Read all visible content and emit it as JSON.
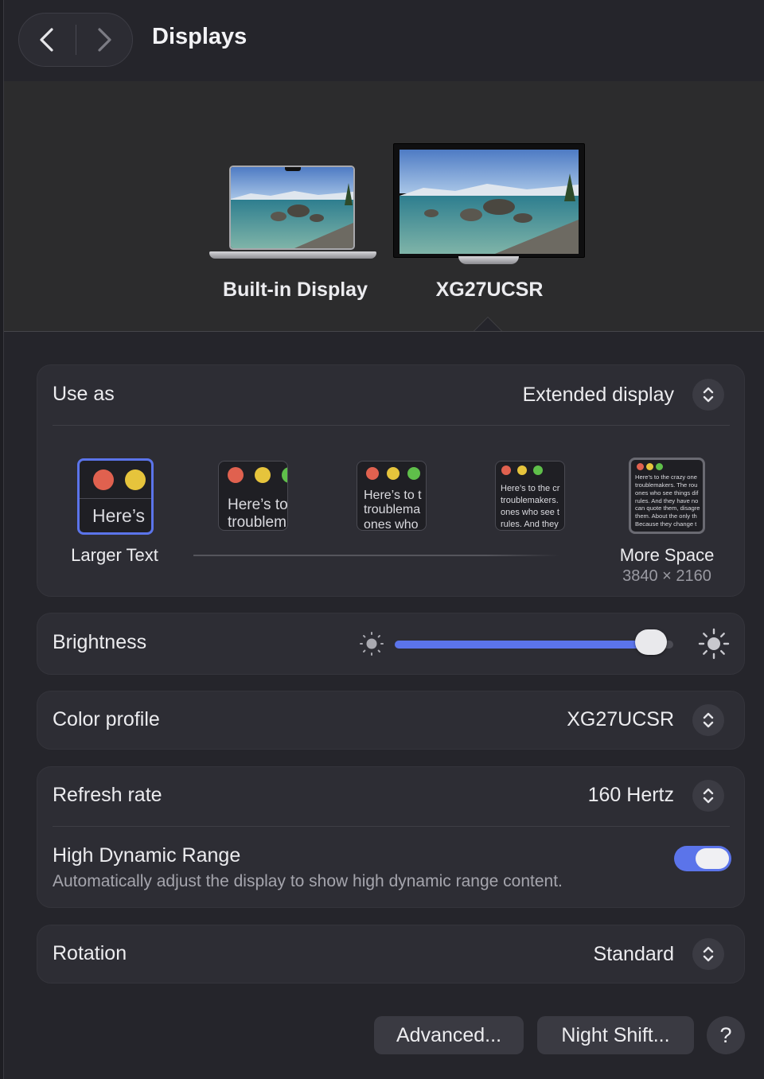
{
  "header": {
    "title": "Displays",
    "back_icon": "chevron-left-icon",
    "forward_icon": "chevron-right-icon"
  },
  "displays": [
    {
      "name": "Built-in Display",
      "icon": "laptop-icon",
      "selected": false
    },
    {
      "name": "XG27UCSR",
      "icon": "monitor-icon",
      "selected": true
    }
  ],
  "use_as": {
    "label": "Use as",
    "value": "Extended display"
  },
  "resolution": {
    "options": [
      {
        "sample": "Here’s",
        "label": "Larger Text",
        "selected": true
      },
      {
        "sample": "Here’s to\ntroublem"
      },
      {
        "sample": "Here’s to t\ntroublema\nones who"
      },
      {
        "sample": "Here’s to the cr\ntroublemakers.\nones who see t\nrules. And they"
      },
      {
        "sample": "Here’s to the crazy one\ntroublemakers. The rou\nones who see things dif\nrules. And they have no\ncan quote them, disagre\nthem. About the only th\nBecause they change t",
        "label": "More Space",
        "sublabel": "3840 × 2160"
      }
    ]
  },
  "brightness": {
    "label": "Brightness",
    "level": 0.92,
    "low_icon": "sun-dim-icon",
    "high_icon": "sun-bright-icon"
  },
  "color_profile": {
    "label": "Color profile",
    "value": "XG27UCSR"
  },
  "refresh_rate": {
    "label": "Refresh rate",
    "value": "160 Hertz"
  },
  "hdr": {
    "label": "High Dynamic Range",
    "description": "Automatically adjust the display to show high dynamic range content.",
    "enabled": true
  },
  "rotation": {
    "label": "Rotation",
    "value": "Standard"
  },
  "buttons": {
    "advanced": "Advanced...",
    "night_shift": "Night Shift...",
    "help": "?"
  },
  "colors": {
    "accent": "#5b74ea",
    "traffic_red": "#e0614f",
    "traffic_yellow": "#e6c43c",
    "traffic_green": "#5fbf4a"
  }
}
